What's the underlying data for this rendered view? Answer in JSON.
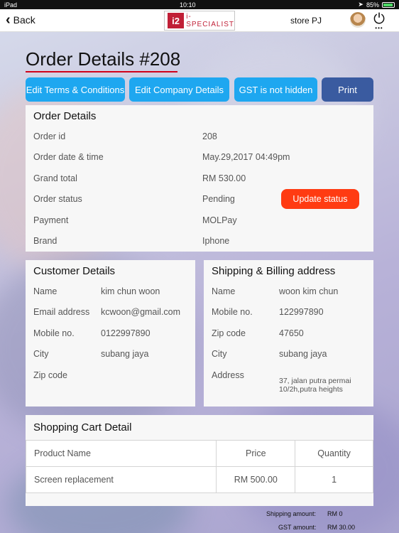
{
  "status_bar": {
    "device": "iPad",
    "time": "10:10",
    "battery": "85%",
    "battery_level": 0.85
  },
  "nav": {
    "back_label": "Back",
    "logo_mark": "i2",
    "logo_text": "i-SPECIALIST",
    "store": "store PJ"
  },
  "page": {
    "title": "Order Details #208"
  },
  "actions": {
    "edit_terms": "Edit Terms & Conditions",
    "edit_company": "Edit Company Details",
    "gst": "GST is not hidden",
    "print": "Print"
  },
  "order_details": {
    "title": "Order Details",
    "rows": [
      {
        "label": "Order id",
        "value": "208"
      },
      {
        "label": "Order date & time",
        "value": "May.29,2017 04:49pm"
      },
      {
        "label": "Grand total",
        "value": "RM 530.00"
      },
      {
        "label": "Order status",
        "value": "Pending"
      },
      {
        "label": "Payment",
        "value": "MOLPay"
      },
      {
        "label": "Brand",
        "value": "Iphone"
      }
    ],
    "update_status_label": "Update status"
  },
  "customer_details": {
    "title": "Customer Details",
    "rows": [
      {
        "label": "Name",
        "value": "kim chun woon"
      },
      {
        "label": "Email address",
        "value": "kcwoon@gmail.com"
      },
      {
        "label": "Mobile no.",
        "value": "0122997890"
      },
      {
        "label": "City",
        "value": "subang jaya"
      },
      {
        "label": "Zip code",
        "value": ""
      }
    ]
  },
  "shipping_billing": {
    "title": "Shipping & Billing address",
    "rows": [
      {
        "label": "Name",
        "value": "woon kim chun"
      },
      {
        "label": "Mobile no.",
        "value": "122997890"
      },
      {
        "label": "Zip code",
        "value": "47650"
      },
      {
        "label": "City",
        "value": "subang jaya"
      },
      {
        "label": "Address",
        "value": "37, jalan putra permai 10/2h,putra heights"
      }
    ]
  },
  "cart": {
    "title": "Shopping Cart Detail",
    "headers": [
      "Product Name",
      "Price",
      "Quantity"
    ],
    "rows": [
      {
        "product": "Screen replacement",
        "price": "RM 500.00",
        "quantity": "1"
      }
    ]
  },
  "summary": {
    "shipping_label": "Shipping amount:",
    "shipping_value": "RM 0",
    "gst_label": "GST amount:",
    "gst_value": "RM 30.00"
  },
  "colors": {
    "accent": "#1ea7f0",
    "print": "#3a5ba0",
    "update": "#ff3b12",
    "title_underline": "#d0021b"
  }
}
